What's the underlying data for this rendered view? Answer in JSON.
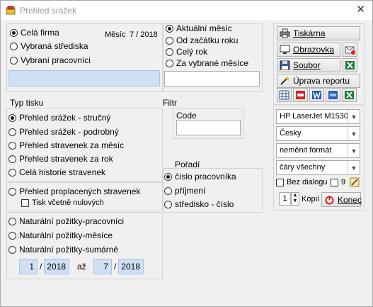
{
  "window": {
    "title": "Přehled srážek",
    "close": "✕"
  },
  "scope": {
    "options": [
      "Celá firma",
      "Vybraná střediska",
      "Vybraní pracovníci"
    ],
    "selected": 0,
    "month_label": "Měsíc",
    "month_value": "7 / 2018"
  },
  "period": {
    "options": [
      "Aktuální měsíc",
      "Od začátku roku",
      "Celý rok",
      "Za vybrané měsíce"
    ],
    "selected": 0
  },
  "print_type": {
    "heading": "Typ tisku",
    "options": [
      "Přehled srážek - stručný",
      "Přehled srážek - podrobný",
      "Přehled stravenek za měsíc",
      "Přehled stravenek za rok",
      "Celá historie stravenek",
      "Přehled proplacených stravenek"
    ],
    "selected": 0,
    "checkbox_label": "Tisk včetně nulových",
    "natural_options": [
      "Naturální požitky-pracovníci",
      "Naturální požitky-měsíce",
      "Naturální požitky-sumárně"
    ],
    "from_month": "1",
    "from_year": "2018",
    "to_label": "až",
    "to_month": "7",
    "to_year": "2018",
    "slash": "/"
  },
  "filter": {
    "heading": "Filtr",
    "code_label": "Code",
    "code_value": ""
  },
  "order": {
    "heading": "Pořadí",
    "options": [
      "číslo pracovníka",
      "příjmení",
      "středisko - číslo"
    ],
    "selected": 0
  },
  "output": {
    "printer_label": "Tiskárna",
    "screen_label": "Obrazovka",
    "file_label": "Soubor",
    "edit_report_label": "Úprava reportu",
    "printer_name": "HP LaserJet M1530",
    "language": "Česky",
    "format": "neměnit formát",
    "lines": "čáry všechny",
    "no_dialog_label": "Bez dialogu",
    "nine_label": "9",
    "copies_value": "1",
    "copies_label": "Kopií",
    "end_label": "Konec"
  }
}
